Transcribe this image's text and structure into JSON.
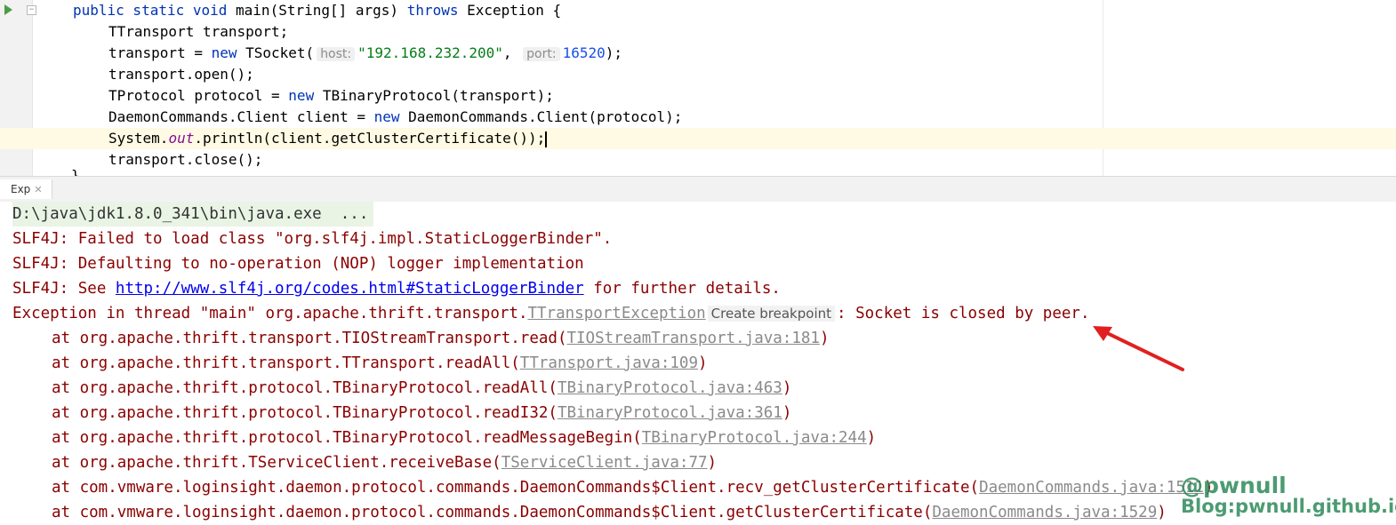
{
  "editor": {
    "lines": [
      {
        "parts": [
          [
            "kw2",
            "public static void "
          ],
          [
            "",
            "main(String[] args) "
          ],
          [
            "kw2",
            "throws "
          ],
          [
            "",
            "Exception {"
          ]
        ]
      },
      {
        "parts": [
          [
            "",
            "TTransport transport;"
          ]
        ]
      },
      {
        "parts": [
          [
            "",
            "transport = "
          ],
          [
            "kw2",
            "new "
          ],
          [
            "",
            "TSocket("
          ],
          [
            "hint",
            "host:"
          ],
          [
            "str",
            "\"192.168.232.200\""
          ],
          [
            "",
            ", "
          ],
          [
            "hint",
            "port:"
          ],
          [
            "num",
            "16520"
          ],
          [
            "",
            ");"
          ]
        ]
      },
      {
        "parts": [
          [
            "",
            "transport.open();"
          ]
        ]
      },
      {
        "parts": [
          [
            "",
            "TProtocol protocol = "
          ],
          [
            "kw2",
            "new "
          ],
          [
            "",
            "TBinaryProtocol(transport);"
          ]
        ]
      },
      {
        "parts": [
          [
            "",
            "DaemonCommands.Client client = "
          ],
          [
            "kw2",
            "new "
          ],
          [
            "",
            "DaemonCommands.Client(protocol);"
          ]
        ]
      },
      {
        "parts": [
          [
            "",
            "System."
          ],
          [
            "field",
            "out"
          ],
          [
            "",
            ".println(client.getClusterCertificate());"
          ]
        ]
      },
      {
        "parts": [
          [
            "",
            "transport.close();"
          ]
        ]
      }
    ],
    "closing_brace": "}"
  },
  "tab": {
    "label": "Exp",
    "close": "✕"
  },
  "console": {
    "cmd": "D:\\java\\jdk1.8.0_341\\bin\\java.exe  ...",
    "slf_1": "SLF4J: Failed to load class \"org.slf4j.impl.StaticLoggerBinder\".",
    "slf_2": "SLF4J: Defaulting to no-operation (NOP) logger implementation",
    "slf_3_pre": "SLF4J: See ",
    "slf_3_link": "http://www.slf4j.org/codes.html#StaticLoggerBinder",
    "slf_3_post": " for further details.",
    "exc_pre": "Exception in thread \"main\" org.apache.thrift.transport.",
    "exc_class": "TTransportException",
    "exc_bp": "Create breakpoint",
    "exc_post": ": Socket is closed by peer.",
    "stack": [
      {
        "at": "at org.apache.thrift.transport.TIOStreamTransport.read(",
        "src": "TIOStreamTransport.java:181",
        "end": ")"
      },
      {
        "at": "at org.apache.thrift.transport.TTransport.readAll(",
        "src": "TTransport.java:109",
        "end": ")"
      },
      {
        "at": "at org.apache.thrift.protocol.TBinaryProtocol.readAll(",
        "src": "TBinaryProtocol.java:463",
        "end": ")"
      },
      {
        "at": "at org.apache.thrift.protocol.TBinaryProtocol.readI32(",
        "src": "TBinaryProtocol.java:361",
        "end": ")"
      },
      {
        "at": "at org.apache.thrift.protocol.TBinaryProtocol.readMessageBegin(",
        "src": "TBinaryProtocol.java:244",
        "end": ")"
      },
      {
        "at": "at org.apache.thrift.TServiceClient.receiveBase(",
        "src": "TServiceClient.java:77",
        "end": ")"
      },
      {
        "at": "at com.vmware.loginsight.daemon.protocol.commands.DaemonCommands$Client.recv_getClusterCertificate(",
        "src": "DaemonCommands.java:1511",
        "end": ")"
      },
      {
        "at": "at com.vmware.loginsight.daemon.protocol.commands.DaemonCommands$Client.getClusterCertificate(",
        "src": "DaemonCommands.java:1529",
        "end": ")"
      }
    ]
  },
  "watermark": {
    "line1": "@pwnull",
    "line2": "Blog:pwnull.github.io"
  },
  "colors": {
    "error": "#8b0000",
    "arrow": "#e02020",
    "watermark": "#2d8a5a"
  }
}
